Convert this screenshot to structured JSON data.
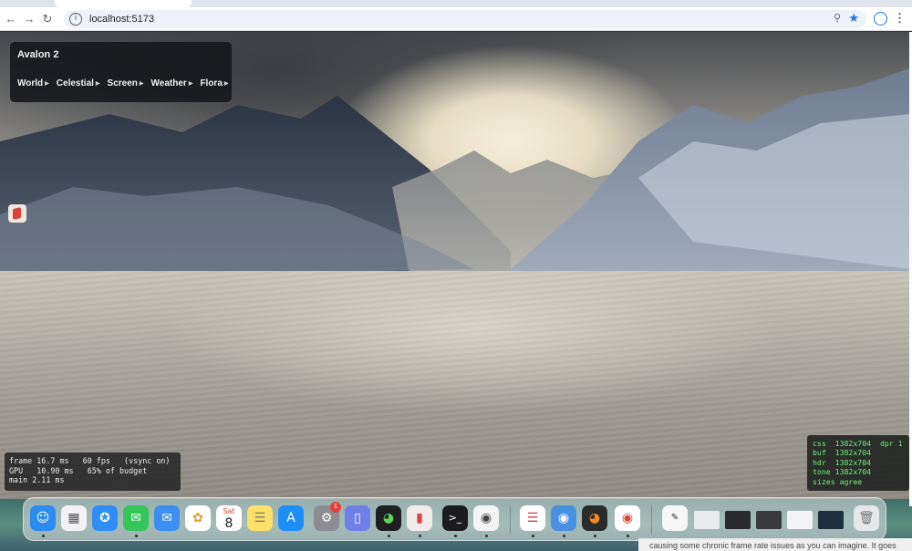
{
  "browser": {
    "url": "localhost:5173"
  },
  "app": {
    "title": "Avalon 2",
    "menus": [
      {
        "label": "World"
      },
      {
        "label": "Celestial"
      },
      {
        "label": "Screen"
      },
      {
        "label": "Weather"
      },
      {
        "label": "Flora"
      }
    ]
  },
  "stats": {
    "line1": "frame 16.7 ms   60 fps   (vsync on)",
    "line2": "GPU   10.90 ms   65% of budget",
    "line3": "main 2.11 ms"
  },
  "sizes": {
    "line1": "css  1382x704  dpr 1",
    "line2": "buf  1382x704",
    "line3": "hdr  1382x704",
    "line4": "tone 1382x704",
    "line5": "sizes agree"
  },
  "dock": {
    "calendar_month": "Sat",
    "calendar_day": "8",
    "settings_badge": "1"
  },
  "background_window": {
    "text": "causing some chronic frame rate issues as you can imagine. It goes"
  },
  "colors": {
    "stats_text": "#ececec",
    "sizes_text": "#6ff07c",
    "panel_bg": "#14161a",
    "chrome_accent": "#1a73e8"
  }
}
